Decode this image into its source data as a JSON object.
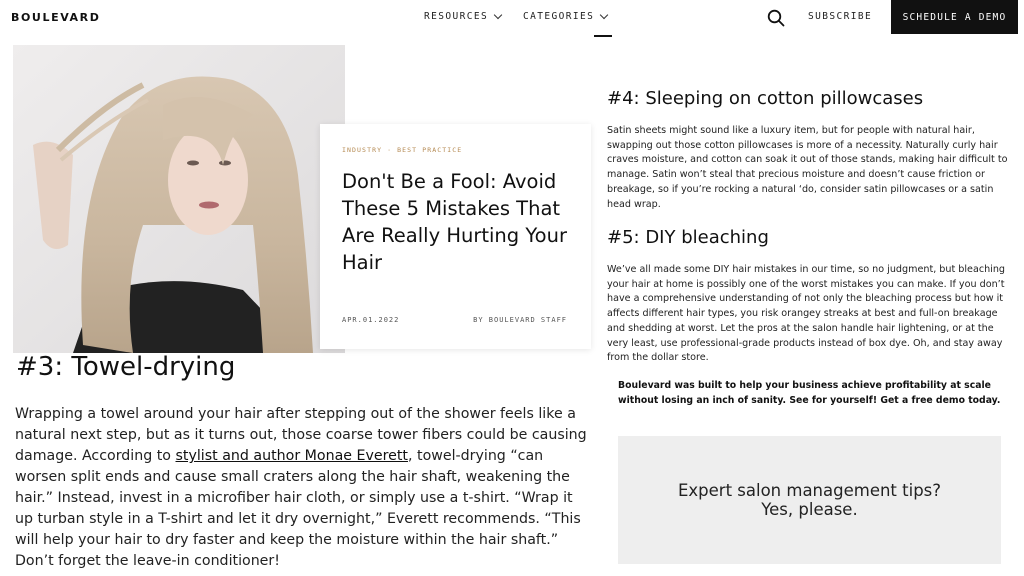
{
  "nav": {
    "logo": "BOULEVARD",
    "resources": "RESOURCES",
    "categories": "CATEGORIES",
    "subscribe": "SUBSCRIBE",
    "demo_button": "SCHEDULE A DEMO"
  },
  "hero": {
    "tag": "INDUSTRY · BEST PRACTICE",
    "title": "Don't Be a Fool: Avoid These 5 Mistakes That Are Really Hurting Your Hair",
    "date": "APR.01.2022",
    "byline": "BY BOULEVARD STAFF"
  },
  "section3": {
    "heading": "#3: Towel-drying",
    "text_1": "Wrapping a towel around your hair after stepping out of the shower feels like a natural next step, but as it turns out, those coarse tower fibers could be causing damage. According to ",
    "link": "stylist and author Monae Everett",
    "text_2": ", towel-drying “can worsen split ends and cause small craters along the hair shaft, weakening the hair.” Instead, invest in a microfiber hair cloth, or simply use a t-shirt. “Wrap it up turban style in a T-shirt and let it dry overnight,” Everett recommends. “This will help your hair to dry faster and keep the moisture within the hair shaft.” Don’t forget the leave-in conditioner!"
  },
  "section4": {
    "heading": "#4: Sleeping on cotton pillowcases",
    "text": "Satin sheets might sound like a luxury item, but for people with natural hair, swapping out those cotton pillowcases is more of a necessity. Naturally curly hair craves moisture, and cotton can soak it out of those stands, making hair difficult to manage. Satin won’t steal that precious moisture and doesn’t cause friction or breakage, so if you’re rocking a natural ‘do, consider satin pillowcases or a satin head wrap."
  },
  "section5": {
    "heading": "#5: DIY bleaching",
    "text": "We’ve all made some DIY hair mistakes in our time, so no judgment, but bleaching your hair at home is possibly one of the worst mistakes you can make. If you don’t have a comprehensive understanding of not only the bleaching process but how it affects different hair types, you risk orangey streaks at best and full-on breakage and shedding at worst. Let the pros at the salon handle hair lightening, or at the very least, use professional-grade products instead of box dye. Oh, and ",
    "link": "stay away from the dollar store",
    "text_end": "."
  },
  "promo": {
    "text": "Boulevard was built to help your business achieve profitability at scale without losing an inch of sanity. See for yourself! ",
    "link": "Get a free demo today",
    "text_end": "."
  },
  "tips_box": {
    "line_1": "Expert salon management tips?",
    "line_2": "Yes, please."
  },
  "colors": {
    "accent_tag": "#b58a52",
    "button_bg": "#111111",
    "tips_bg": "#eeeeee"
  }
}
